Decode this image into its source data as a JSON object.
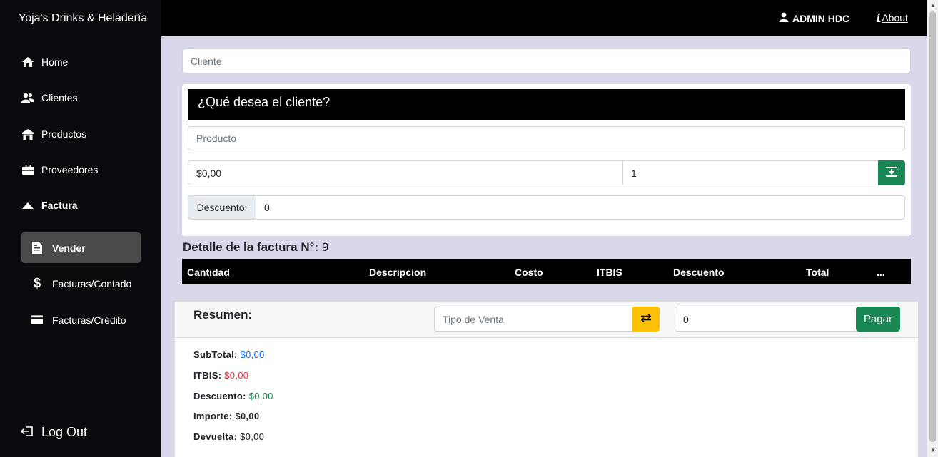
{
  "app": {
    "title": "Yoja's Drinks & Heladería"
  },
  "topbar": {
    "user": "ADMIN HDC",
    "about": "About"
  },
  "sidebar": {
    "items": [
      {
        "label": "Home",
        "icon": "home-icon"
      },
      {
        "label": "Clientes",
        "icon": "users-icon"
      },
      {
        "label": "Productos",
        "icon": "store-icon"
      },
      {
        "label": "Proveedores",
        "icon": "briefcase-icon"
      },
      {
        "label": "Factura",
        "icon": "caret-up-icon"
      }
    ],
    "subitems": [
      {
        "label": "Vender",
        "icon": "document-icon",
        "active": true
      },
      {
        "label": "Facturas/Contado",
        "icon": "dollar-icon"
      },
      {
        "label": "Facturas/Crédito",
        "icon": "credit-card-icon"
      }
    ],
    "logout": "Log Out"
  },
  "form": {
    "cliente_placeholder": "Cliente",
    "card_title": "¿Qué desea el cliente?",
    "producto_placeholder": "Producto",
    "precio_value": "$0,00",
    "cantidad_value": "1",
    "descuento_label": "Descuento:",
    "descuento_value": "0"
  },
  "detalle": {
    "title": "Detalle de la factura N°:",
    "number": "9",
    "columns": [
      "Cantidad",
      "Descripcion",
      "Costo",
      "ITBIS",
      "Descuento",
      "Total",
      "..."
    ]
  },
  "resumen": {
    "title": "Resumen:",
    "tipo_venta_placeholder": "Tipo de Venta",
    "monto_value": "0",
    "pagar_label": "Pagar",
    "lines": [
      {
        "label": "SubTotal:",
        "value": "$0,00",
        "color": "#0d6efd"
      },
      {
        "label": "ITBIS:",
        "value": "$0,00",
        "color": "#dc3545"
      },
      {
        "label": "Descuento:",
        "value": "$0,00",
        "color": "#198754"
      },
      {
        "label": "Importe:",
        "value": "$0,00",
        "color": "#212529"
      },
      {
        "label": "Devuelta:",
        "value": "$0,00",
        "color": "#212529"
      }
    ]
  },
  "colors": {
    "accent_green": "#198754",
    "accent_yellow": "#ffc107",
    "sidebar_bg": "#0b0b0f",
    "page_bg": "#d8d8ea"
  }
}
